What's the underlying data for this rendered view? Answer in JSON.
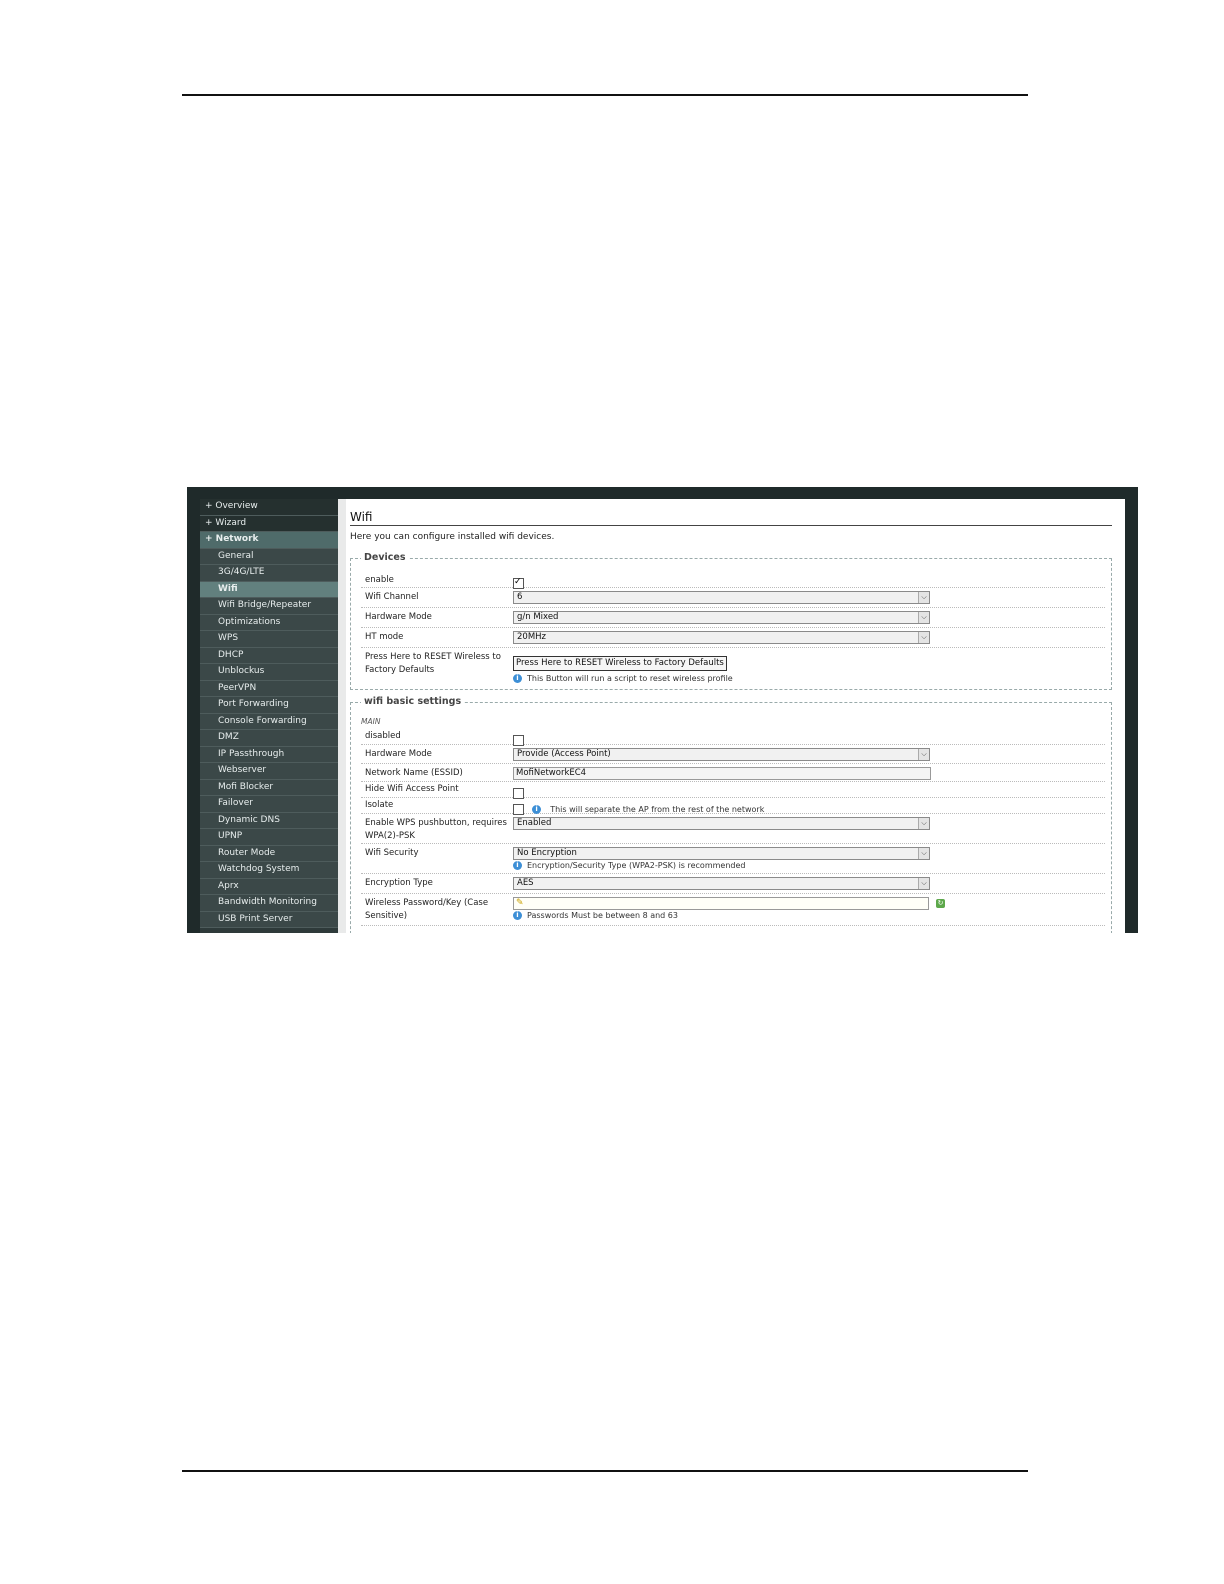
{
  "sidebar": {
    "items": [
      {
        "label": "+ Overview",
        "level": "top",
        "active": false
      },
      {
        "label": "+ Wizard",
        "level": "top",
        "active": false
      },
      {
        "label": "+ Network",
        "level": "top",
        "active": true
      },
      {
        "label": "General",
        "level": "sub",
        "active": false
      },
      {
        "label": "3G/4G/LTE",
        "level": "sub",
        "active": false
      },
      {
        "label": "Wifi",
        "level": "sub",
        "active": true
      },
      {
        "label": "Wifi Bridge/Repeater",
        "level": "sub",
        "active": false
      },
      {
        "label": "Optimizations",
        "level": "sub",
        "active": false
      },
      {
        "label": "WPS",
        "level": "sub",
        "active": false
      },
      {
        "label": "DHCP",
        "level": "sub",
        "active": false
      },
      {
        "label": "Unblockus",
        "level": "sub",
        "active": false
      },
      {
        "label": "PeerVPN",
        "level": "sub",
        "active": false
      },
      {
        "label": "Port Forwarding",
        "level": "sub",
        "active": false
      },
      {
        "label": "Console Forwarding",
        "level": "sub",
        "active": false
      },
      {
        "label": "DMZ",
        "level": "sub",
        "active": false
      },
      {
        "label": "IP Passthrough",
        "level": "sub",
        "active": false
      },
      {
        "label": "Webserver",
        "level": "sub",
        "active": false
      },
      {
        "label": "Mofi Blocker",
        "level": "sub",
        "active": false
      },
      {
        "label": "Failover",
        "level": "sub",
        "active": false
      },
      {
        "label": "Dynamic DNS",
        "level": "sub",
        "active": false
      },
      {
        "label": "UPNP",
        "level": "sub",
        "active": false
      },
      {
        "label": "Router Mode",
        "level": "sub",
        "active": false
      },
      {
        "label": "Watchdog System",
        "level": "sub",
        "active": false
      },
      {
        "label": "Aprx",
        "level": "sub",
        "active": false
      },
      {
        "label": "Bandwidth Monitoring",
        "level": "sub",
        "active": false
      },
      {
        "label": "USB Print Server",
        "level": "sub",
        "active": false
      }
    ]
  },
  "page": {
    "title": "Wifi",
    "description": "Here you can configure installed wifi devices."
  },
  "devices": {
    "legend": "Devices",
    "enable_label": "enable",
    "enable_checked": true,
    "channel_label": "Wifi Channel",
    "channel_value": "6",
    "hwmode_label": "Hardware Mode",
    "hwmode_value": "g/n Mixed",
    "htmode_label": "HT mode",
    "htmode_value": "20MHz",
    "reset_label": "Press Here to RESET Wireless to Factory Defaults",
    "reset_button": "Press Here to RESET Wireless to Factory Defaults",
    "reset_hint": "This Button will run a script to reset wireless profile"
  },
  "basic": {
    "legend": "wifi basic settings",
    "section_label": "MAIN",
    "disabled_label": "disabled",
    "disabled_checked": false,
    "hwmode_label": "Hardware Mode",
    "hwmode_value": "Provide (Access Point)",
    "essid_label": "Network Name (ESSID)",
    "essid_value": "MofiNetworkEC4",
    "hide_label": "Hide Wifi Access Point",
    "hide_checked": false,
    "isolate_label": "Isolate",
    "isolate_checked": false,
    "isolate_hint": "This will separate the AP from the rest of the network",
    "wps_label": "Enable WPS pushbutton, requires WPA(2)-PSK",
    "wps_value": "Enabled",
    "security_label": "Wifi Security",
    "security_value": "No Encryption",
    "security_hint": "Encryption/Security Type (WPA2-PSK) is recommended",
    "enctype_label": "Encryption Type",
    "enctype_value": "AES",
    "password_label": "Wireless Password/Key (Case Sensitive)",
    "password_value": "",
    "password_hint": "Passwords Must be between 8 and 63"
  },
  "icons": {
    "dropdown": "chevron-down-icon",
    "info": "info-icon",
    "key": "key-icon",
    "reveal": "reveal-password-icon"
  },
  "colors": {
    "sidebar_bg": "#2e3a3a",
    "sidebar_active": "#62807e",
    "info_blue": "#3d8fd6"
  }
}
